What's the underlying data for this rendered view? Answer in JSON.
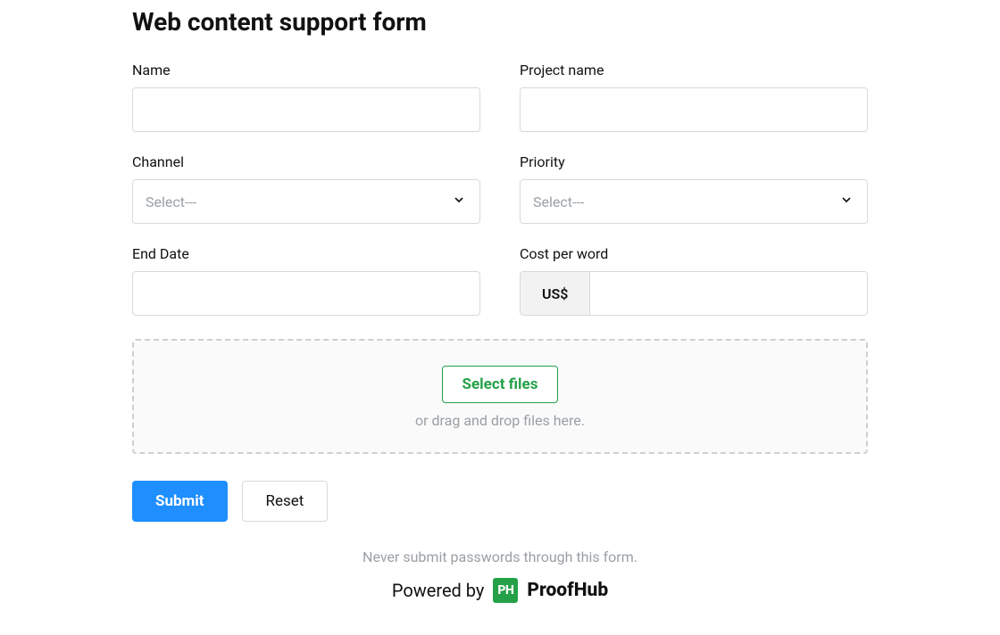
{
  "title": "Web content support form",
  "fields": {
    "name": {
      "label": "Name",
      "value": ""
    },
    "project_name": {
      "label": "Project name",
      "value": ""
    },
    "channel": {
      "label": "Channel",
      "placeholder": "Select---"
    },
    "priority": {
      "label": "Priority",
      "placeholder": "Select---"
    },
    "end_date": {
      "label": "End Date",
      "value": ""
    },
    "cost_per_word": {
      "label": "Cost per word",
      "currency_prefix": "US$",
      "value": ""
    }
  },
  "dropzone": {
    "button": "Select files",
    "text": "or drag and drop files here."
  },
  "actions": {
    "submit": "Submit",
    "reset": "Reset"
  },
  "footer": {
    "warning": "Never submit passwords through this form.",
    "powered_by_label": "Powered by",
    "brand_badge": "PH",
    "brand_name": "ProofHub"
  }
}
